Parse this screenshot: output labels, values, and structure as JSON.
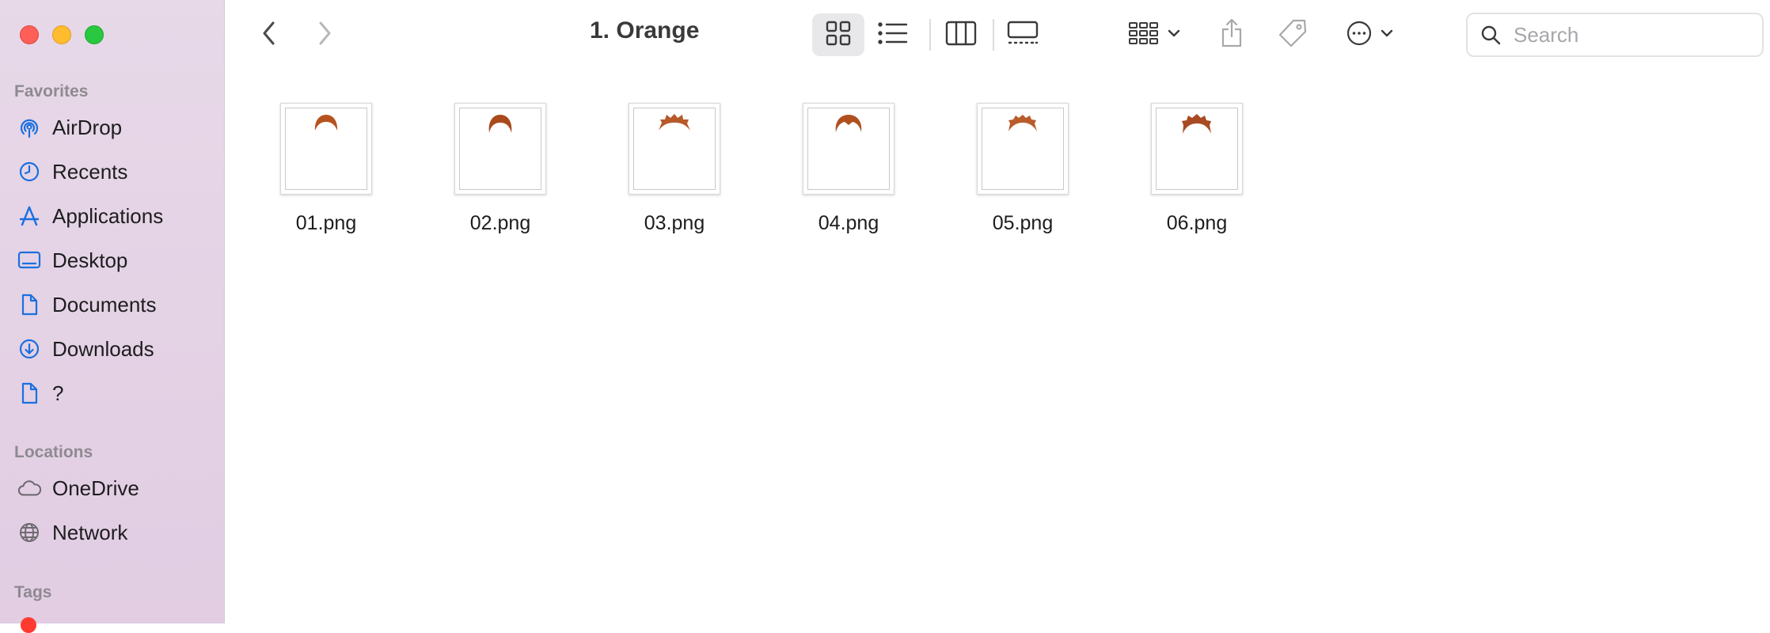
{
  "window": {
    "title": "1. Orange"
  },
  "sidebar": {
    "favorites_title": "Favorites",
    "favorites": [
      {
        "label": "AirDrop",
        "icon": "airdrop-icon"
      },
      {
        "label": "Recents",
        "icon": "clock-icon"
      },
      {
        "label": "Applications",
        "icon": "applications-icon"
      },
      {
        "label": "Desktop",
        "icon": "desktop-icon"
      },
      {
        "label": "Documents",
        "icon": "document-icon"
      },
      {
        "label": "Downloads",
        "icon": "download-icon"
      },
      {
        "label": "?",
        "icon": "document-icon"
      }
    ],
    "locations_title": "Locations",
    "locations": [
      {
        "label": "OneDrive",
        "icon": "cloud-icon"
      },
      {
        "label": "Network",
        "icon": "globe-icon"
      }
    ],
    "tags_title": "Tags"
  },
  "toolbar": {
    "search_placeholder": "Search"
  },
  "files": [
    {
      "name": "01.png",
      "hair_color": "#b5531e"
    },
    {
      "name": "02.png",
      "hair_color": "#a94a1c"
    },
    {
      "name": "03.png",
      "hair_color": "#b65a2a"
    },
    {
      "name": "04.png",
      "hair_color": "#b0501f"
    },
    {
      "name": "05.png",
      "hair_color": "#b85c2c"
    },
    {
      "name": "06.png",
      "hair_color": "#a84a22"
    }
  ],
  "colors": {
    "accent": "#1a6fe0",
    "sidebar_bg": "#e5d5e6"
  }
}
